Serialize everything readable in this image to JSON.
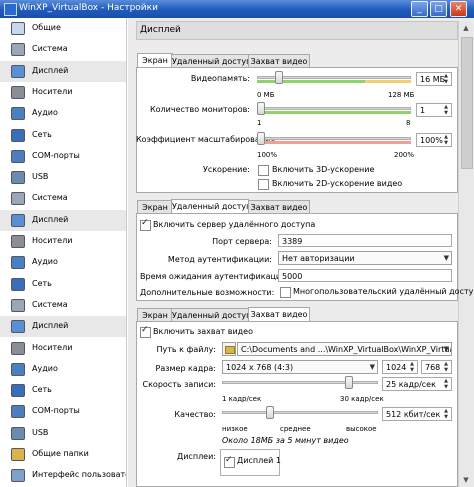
{
  "window": {
    "title": "WinXP_VirtualBox - Настройки",
    "btn_min": "_",
    "btn_max": "□",
    "btn_close": "✕"
  },
  "sidebar": {
    "items": [
      {
        "label": "Общие",
        "icon": "general-icon",
        "selected": false
      },
      {
        "label": "Система",
        "icon": "system-icon",
        "selected": false
      },
      {
        "label": "Дисплей",
        "icon": "display-icon",
        "selected": true
      },
      {
        "label": "Носители",
        "icon": "storage-icon",
        "selected": false
      },
      {
        "label": "Аудио",
        "icon": "audio-icon",
        "selected": false
      },
      {
        "label": "Сеть",
        "icon": "network-icon",
        "selected": false
      },
      {
        "label": "COM-порты",
        "icon": "serial-icon",
        "selected": false
      },
      {
        "label": "USB",
        "icon": "usb-icon",
        "selected": false
      },
      {
        "label": "Система",
        "icon": "system-icon",
        "selected": false
      },
      {
        "label": "Дисплей",
        "icon": "display-icon",
        "selected": true
      },
      {
        "label": "Носители",
        "icon": "storage-icon",
        "selected": false
      },
      {
        "label": "Аудио",
        "icon": "audio-icon",
        "selected": false
      },
      {
        "label": "Сеть",
        "icon": "network-icon",
        "selected": false
      },
      {
        "label": "Система",
        "icon": "system-icon",
        "selected": false
      },
      {
        "label": "Дисплей",
        "icon": "display-icon",
        "selected": true
      },
      {
        "label": "Носители",
        "icon": "storage-icon",
        "selected": false
      },
      {
        "label": "Аудио",
        "icon": "audio-icon",
        "selected": false
      },
      {
        "label": "Сеть",
        "icon": "network-icon",
        "selected": false
      },
      {
        "label": "COM-порты",
        "icon": "serial-icon",
        "selected": false
      },
      {
        "label": "USB",
        "icon": "usb-icon",
        "selected": false
      },
      {
        "label": "Общие папки",
        "icon": "shared-folders-icon",
        "selected": false
      },
      {
        "label": "Интерфейс пользователя",
        "icon": "user-interface-icon",
        "selected": false
      }
    ]
  },
  "section_title": "Дисплей",
  "screen_block": {
    "tabs": [
      "Экран",
      "Удаленный доступ",
      "Захват видео"
    ],
    "active_tab": 0,
    "video_memory": {
      "label": "Видеопамять:",
      "value": "16 МБ",
      "min_label": "0 МБ",
      "max_label": "128 МБ",
      "level": 0.125
    },
    "monitors": {
      "label": "Количество мониторов:",
      "value": "1",
      "min_label": "1",
      "max_label": "8",
      "level": 0
    },
    "scale": {
      "label": "Коэффициент масштабирования:",
      "value": "100%",
      "min_label": "100%",
      "max_label": "200%",
      "level": 0
    },
    "acceleration": {
      "label": "Ускорение:",
      "opt_3d": "Включить 3D-ускорение",
      "opt_2d": "Включить 2D-ускорение видео",
      "checked_3d": false,
      "checked_2d": false
    }
  },
  "remote_block": {
    "tabs": [
      "Экран",
      "Удаленный доступ",
      "Захват видео"
    ],
    "active_tab": 1,
    "enable_label": "Включить сервер удалённого доступа",
    "enabled": true,
    "port": {
      "label": "Порт сервера:",
      "value": "3389"
    },
    "auth_method": {
      "label": "Метод аутентификации:",
      "value": "Нет авторизации"
    },
    "auth_timeout": {
      "label": "Время ожидания аутентификации:",
      "value": "5000"
    },
    "extended": {
      "label": "Дополнительные возможности:",
      "option": "Многопользовательский удалённый доступ",
      "checked": false
    }
  },
  "capture_block": {
    "tabs": [
      "Экран",
      "Удаленный доступ",
      "Захват видео"
    ],
    "active_tab": 2,
    "enable_label": "Включить захват видео",
    "enabled": true,
    "file_path": {
      "label": "Путь к файлу:",
      "value": "C:\\Documents and ...\\WinXP_VirtualBox\\WinXP_VirtualBox.webm"
    },
    "frame_size": {
      "label": "Размер кадра:",
      "value": "1024 x 768 (4:3)",
      "width": "1024",
      "height": "768"
    },
    "frame_rate": {
      "label": "Скорость записи:",
      "value": "25 кадр/сек",
      "min_label": "1 кадр/сек",
      "max_label": "30 кадр/сек",
      "level": 0.83
    },
    "quality": {
      "label": "Качество:",
      "value": "512 кбит/сек",
      "low": "низкое",
      "medium": "среднее",
      "high": "высокое",
      "level": 0.3
    },
    "size_hint": "Около 18МБ за 5 минут видео",
    "screens": {
      "label": "Дисплеи:",
      "option": "Дисплей 1",
      "checked": true
    }
  },
  "colors": {
    "title_bar": "#1f5bbd",
    "green_zone": "#8fd46a",
    "red_zone": "#f0a090",
    "selected_item": "#e8e8e8"
  }
}
